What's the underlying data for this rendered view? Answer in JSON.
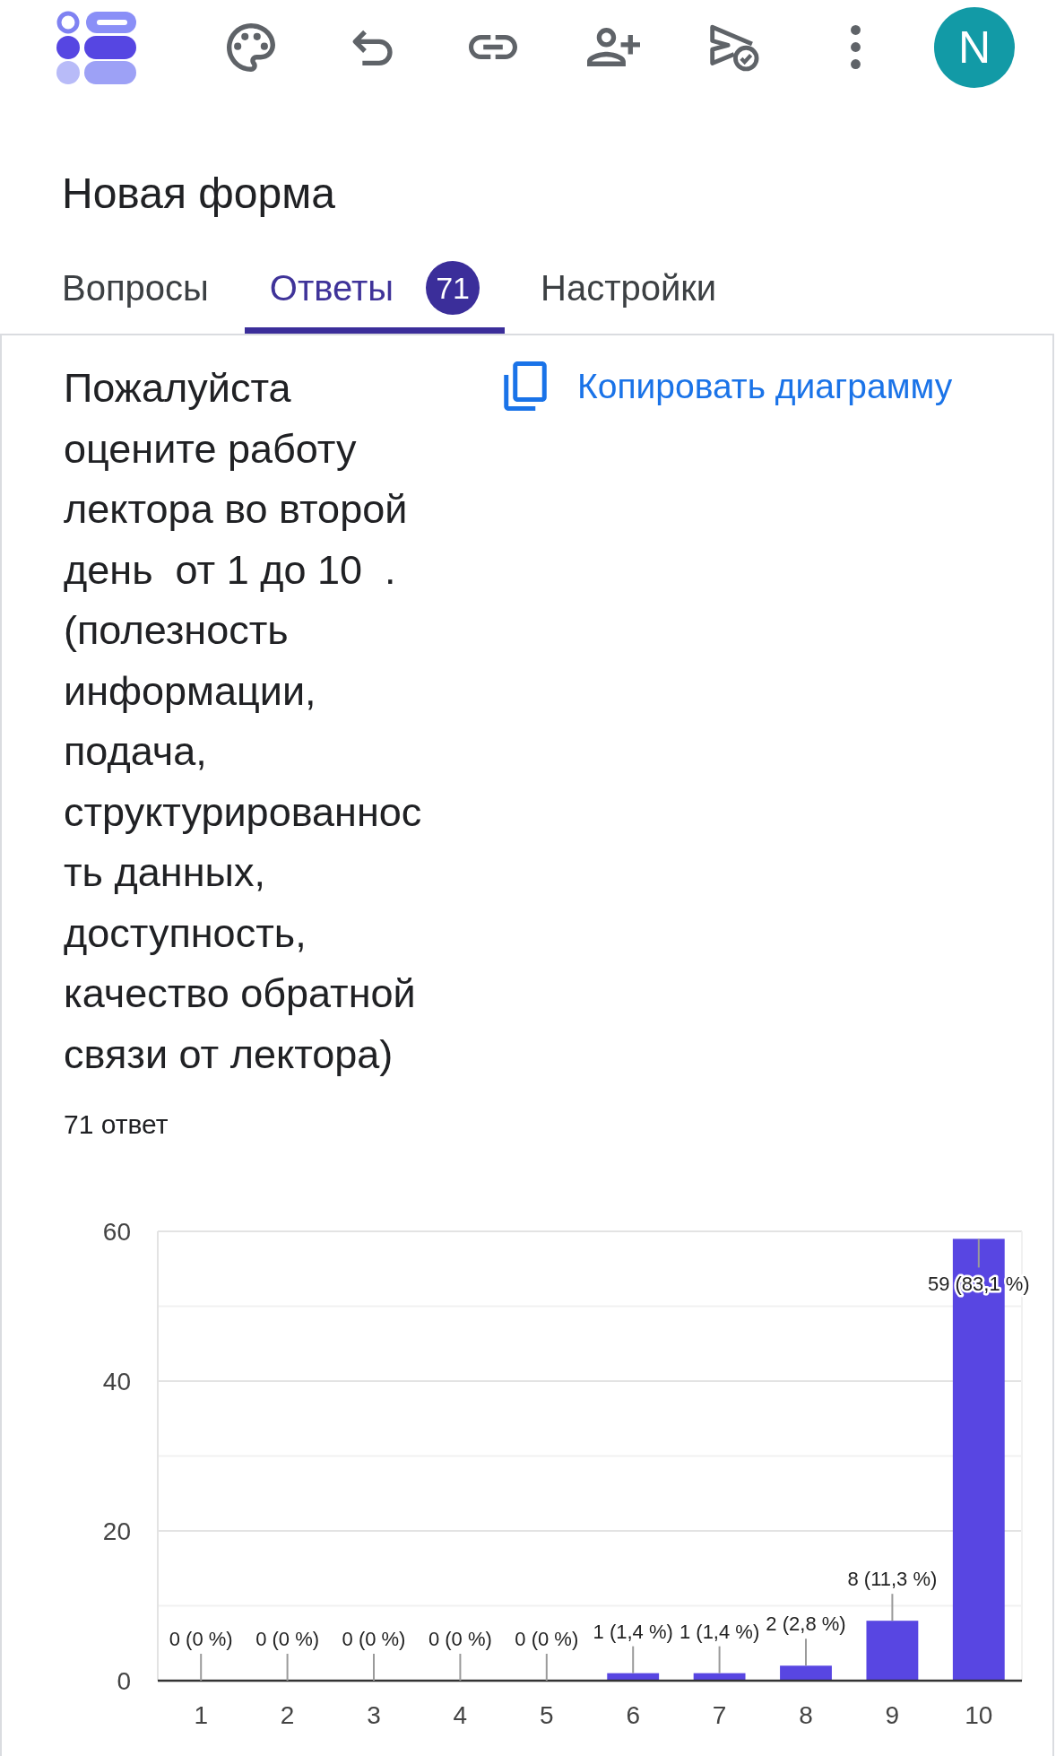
{
  "toolbar": {
    "avatar": {
      "letter": "N"
    }
  },
  "form_title": "Новая форма",
  "tabs": [
    {
      "label": "Вопросы",
      "selected": false
    },
    {
      "label": "Ответы",
      "selected": true,
      "badge": "71"
    },
    {
      "label": "Настройки",
      "selected": false
    }
  ],
  "question": {
    "text": "Пожалуйста оцените работу лектора во второй день  от 1 до 10  . (полезность информации, подача, структурированность данных, доступность, качество обратной связи от лектора)",
    "copy_chart_button": "Копировать диаграмму",
    "response_count": "71 ответ",
    "chart_data": {
      "type": "bar",
      "categories": [
        "1",
        "2",
        "3",
        "4",
        "5",
        "6",
        "7",
        "8",
        "9",
        "10"
      ],
      "values": [
        0,
        0,
        0,
        0,
        0,
        1,
        1,
        2,
        8,
        59
      ],
      "ylim": [
        0,
        60
      ],
      "yticks": [
        0,
        20,
        40,
        60
      ],
      "value_labels": [
        "0 (0 %)",
        "0 (0 %)",
        "0 (0 %)",
        "0 (0 %)",
        "0 (0 %)",
        "1 (1,4 %)",
        "1 (1,4 %)",
        "2 (2,8 %)",
        "8 (11,3 %)",
        "59 (83,1 %)"
      ]
    }
  }
}
